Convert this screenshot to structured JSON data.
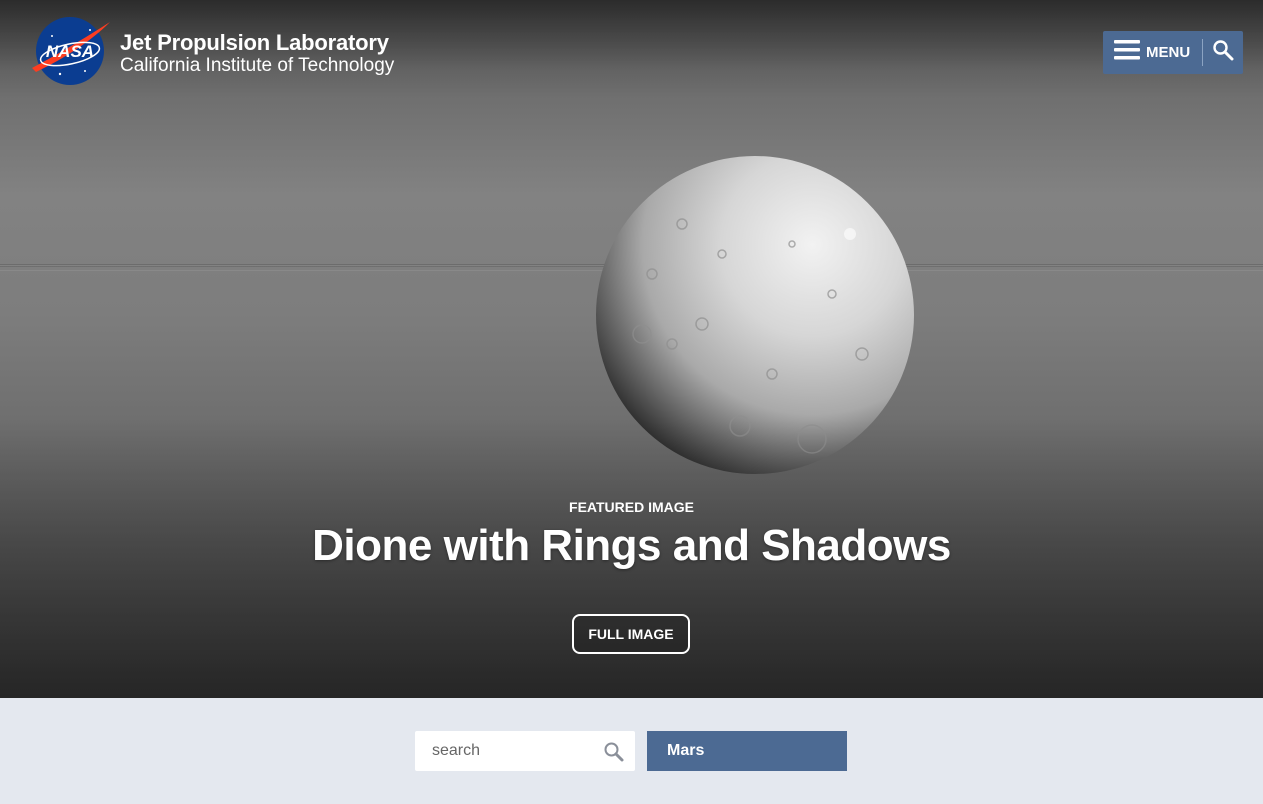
{
  "header": {
    "logo_icon": "nasa-meatball-icon",
    "logo_text": "NASA",
    "org_name": "Jet Propulsion Laboratory",
    "org_subtitle": "California Institute of Technology",
    "menu_label": "MENU",
    "menu_icon": "hamburger-icon",
    "search_icon": "search-icon"
  },
  "hero": {
    "kicker": "FEATURED IMAGE",
    "title": "Dione with Rings and Shadows",
    "button_label": "FULL IMAGE"
  },
  "search_bar": {
    "placeholder": "search",
    "value": "",
    "icon": "search-icon",
    "filter_selected": "Mars"
  },
  "colors": {
    "accent": "#4c6a93",
    "panel_bg": "#e4e8ef",
    "nasa_blue": "#0b3d91",
    "nasa_red": "#fc3d21"
  }
}
